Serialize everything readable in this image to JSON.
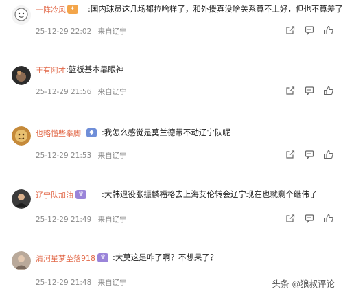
{
  "comments": [
    {
      "user": "一阵冷风",
      "badge": "",
      "text": ":国内球员这几场都拉啥样了，和外援真没啥关系算不上好，但也不算差了",
      "time": "25-12-29 22:02",
      "location": "来自辽宁"
    },
    {
      "user": "王有阿才",
      "badge": "",
      "text": ":篮板基本靠眼神",
      "time": "25-12-29 21:56",
      "location": "来自辽宁"
    },
    {
      "user": "也略懂些拳脚",
      "badge": "",
      "text": ":我怎么感觉是莫兰德带不动辽宁队呢",
      "time": "25-12-29 21:53",
      "location": "来自辽宁"
    },
    {
      "user": "辽宁队加油",
      "badge": "",
      "text": ":大韩退役张振麟福格去上海艾伦转会辽宁现在也就剩个继伟了",
      "time": "25-12-29 21:49",
      "location": "来自辽宁"
    },
    {
      "user": "清河星梦坠落918",
      "badge": "",
      "text": ":大莫这是咋了啊？不想呆了？",
      "time": "25-12-29 21:48",
      "location": "来自辽宁"
    }
  ],
  "icons": [
    "share-icon",
    "comment-icon",
    "like-icon"
  ],
  "watermark": "头条 @狼叔评论"
}
